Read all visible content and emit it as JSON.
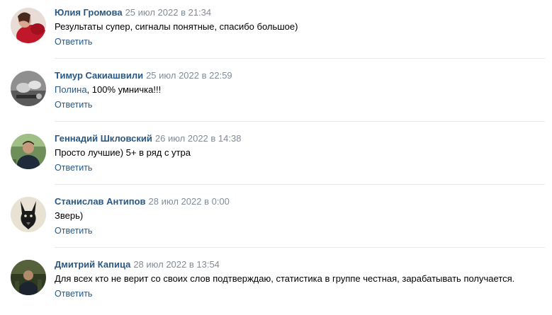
{
  "comments": [
    {
      "author": "Юлия Громова",
      "date": "25 июл 2022 в 21:34",
      "mention": "",
      "text": "Результаты супер, сигналы понятные, спасибо большое)",
      "reply_label": "Ответить",
      "avatar_icon": "user-photo-red-icon"
    },
    {
      "author": "Тимур Сакиашвили",
      "date": "25 июл 2022 в 22:59",
      "mention": "Полина",
      "text": ", 100% умничка!!!",
      "reply_label": "Ответить",
      "avatar_icon": "user-photo-gray-icon"
    },
    {
      "author": "Геннадий Шкловский",
      "date": "26 июл 2022 в 14:38",
      "mention": "",
      "text": "Просто лучшие) 5+ в ряд с утра",
      "reply_label": "Ответить",
      "avatar_icon": "user-photo-outdoor-icon"
    },
    {
      "author": "Станислав Антипов",
      "date": "28 июл 2022 в 0:00",
      "mention": "",
      "text": "Зверь)",
      "reply_label": "Ответить",
      "avatar_icon": "dog-drawing-icon"
    },
    {
      "author": "Дмитрий Капица",
      "date": "28 июл 2022 в 13:54",
      "mention": "",
      "text": "Для всех кто не верит со своих слов подтверждаю, статистика в группе честная, зарабатывать получается.",
      "reply_label": "Ответить",
      "avatar_icon": "user-photo-dark-icon"
    }
  ],
  "colors": {
    "link": "#2a5885",
    "date": "#818c99",
    "divider": "#e7e8ec"
  }
}
